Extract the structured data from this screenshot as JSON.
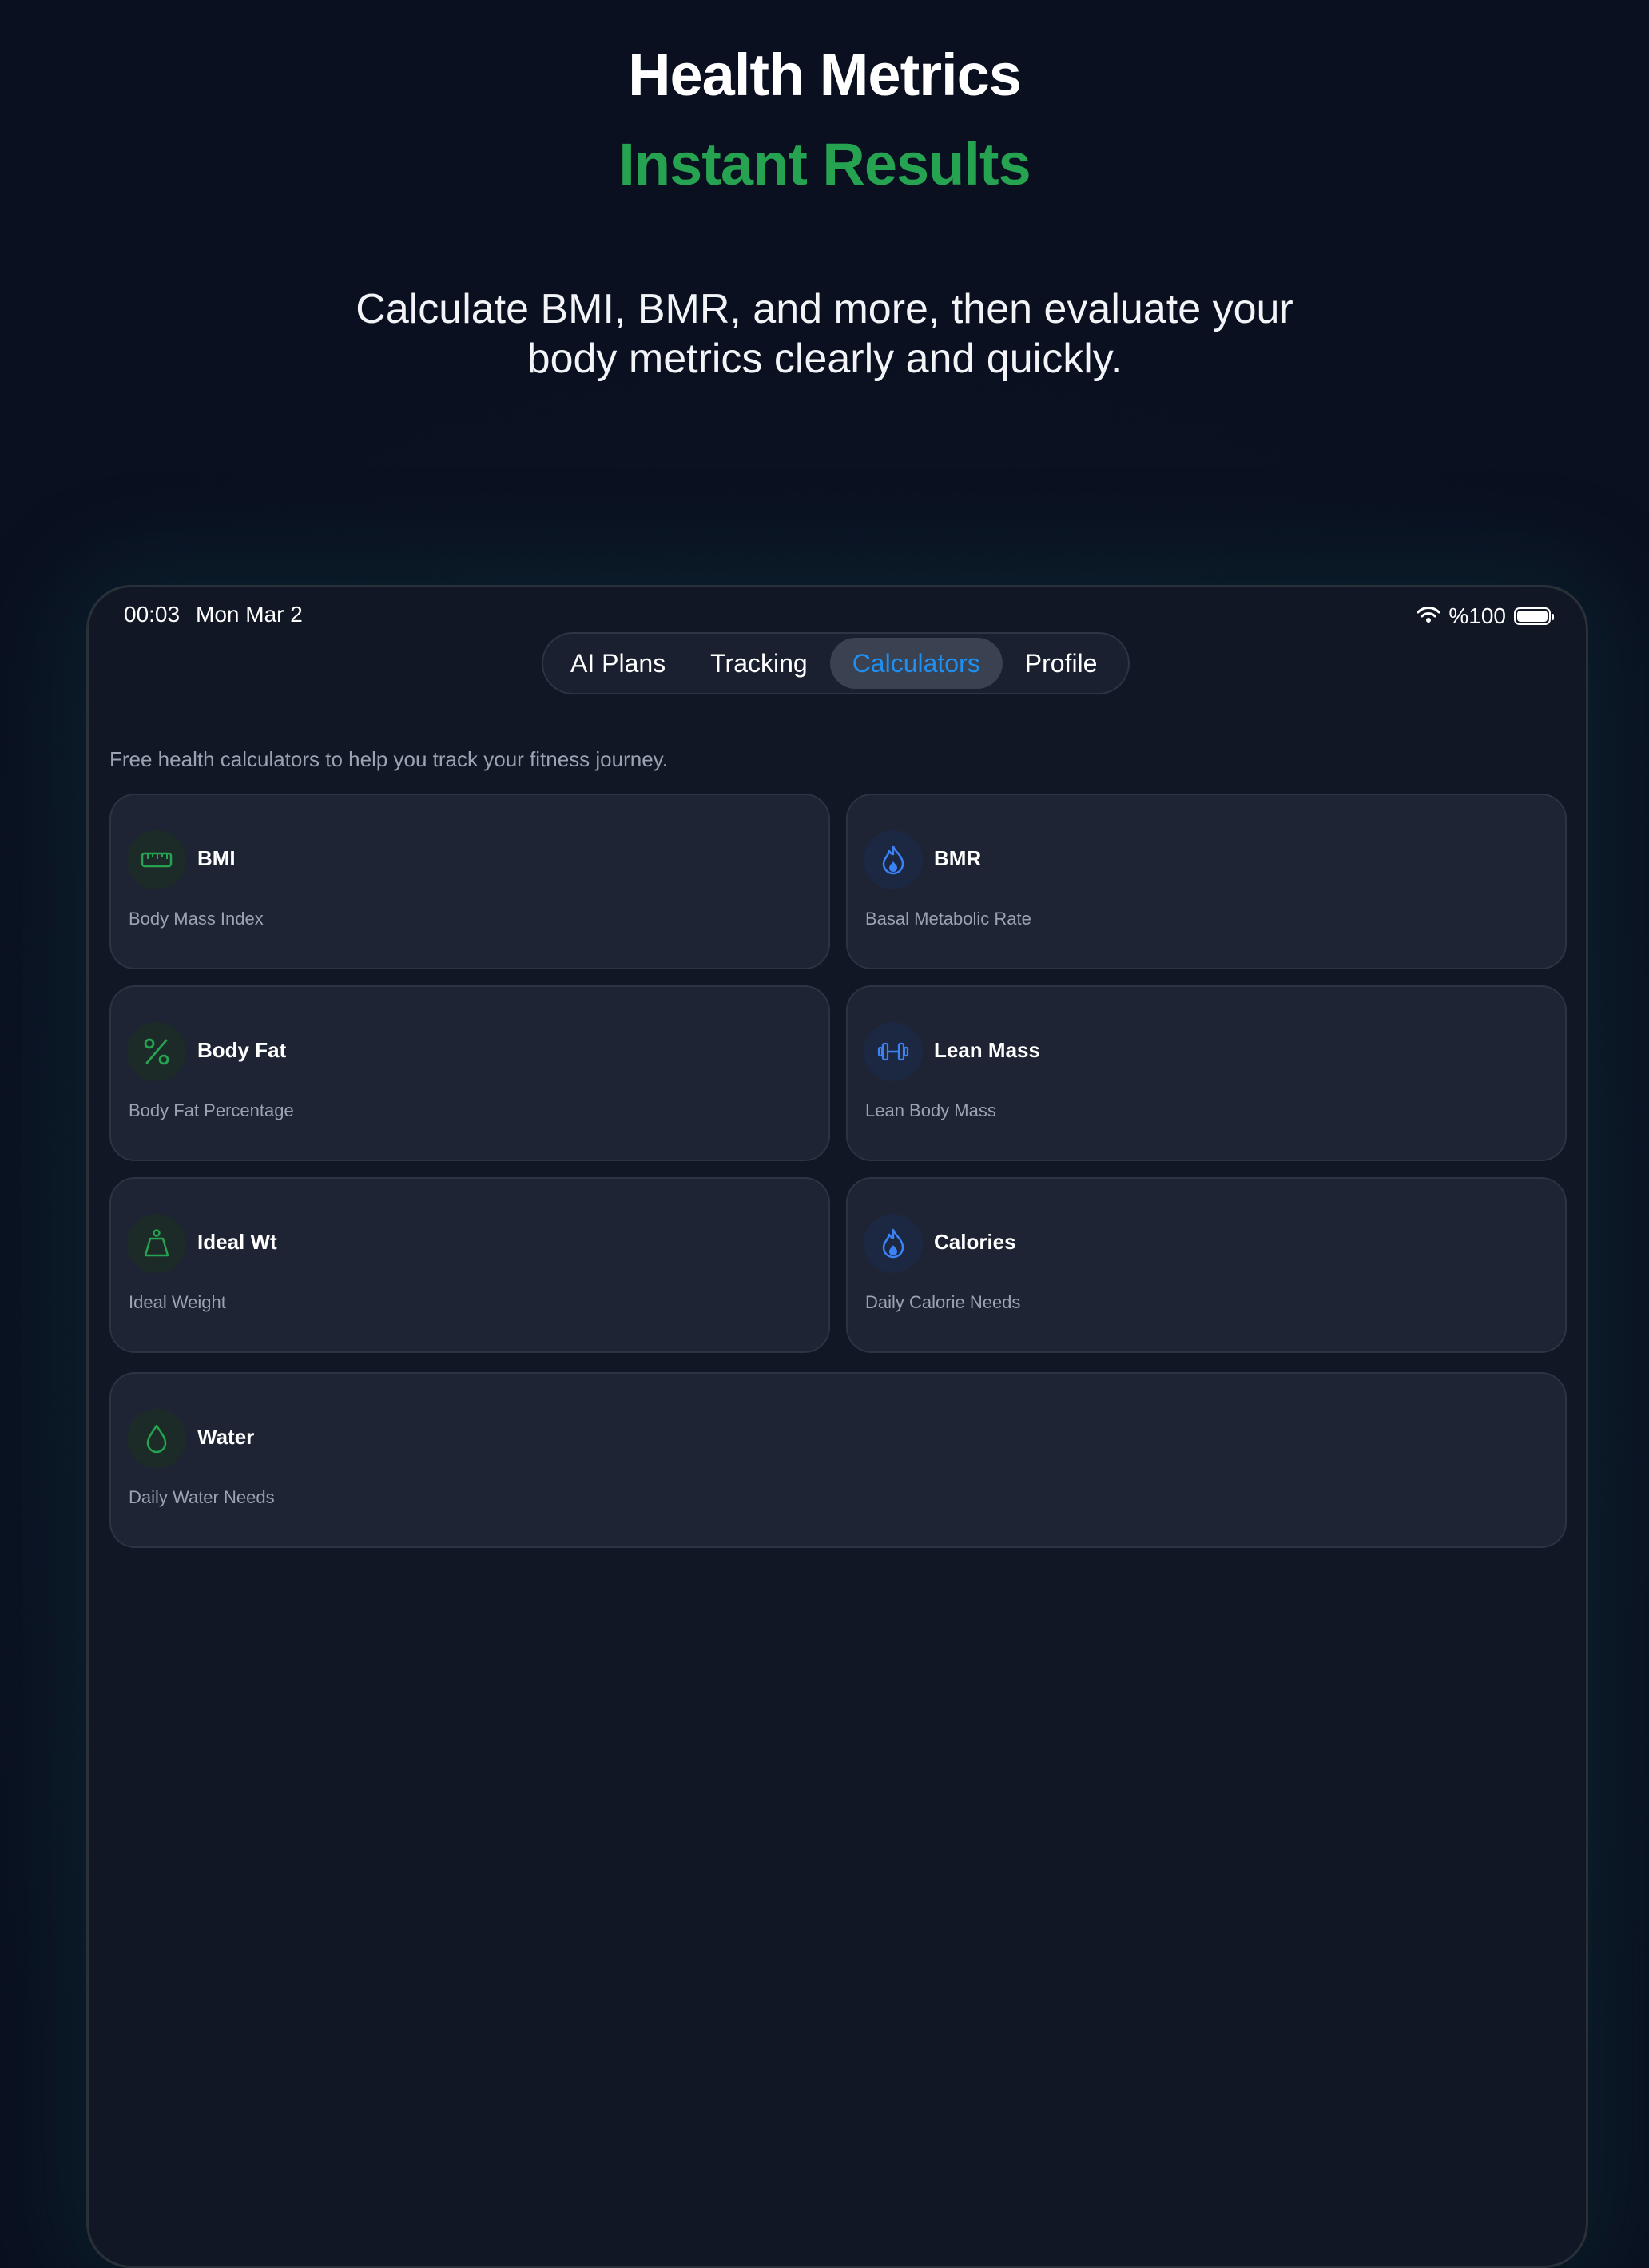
{
  "hero": {
    "title": "Health Metrics",
    "subtitle": "Instant Results",
    "description": "Calculate BMI, BMR, and more, then evaluate your body metrics clearly and quickly."
  },
  "status_bar": {
    "time": "00:03",
    "date": "Mon Mar 2",
    "battery": "%100"
  },
  "tabs": [
    {
      "label": "AI Plans",
      "active": false
    },
    {
      "label": "Tracking",
      "active": false
    },
    {
      "label": "Calculators",
      "active": true
    },
    {
      "label": "Profile",
      "active": false
    }
  ],
  "intro": "Free health calculators to help you track your fitness journey.",
  "calculators": [
    {
      "title": "BMI",
      "subtitle": "Body Mass Index",
      "icon": "ruler-icon",
      "accent": "#26a350"
    },
    {
      "title": "BMR",
      "subtitle": "Basal Metabolic Rate",
      "icon": "flame-icon",
      "accent": "#3b82f6"
    },
    {
      "title": "Body Fat",
      "subtitle": "Body Fat Percentage",
      "icon": "percent-icon",
      "accent": "#26a350"
    },
    {
      "title": "Lean Mass",
      "subtitle": "Lean Body Mass",
      "icon": "dumbbell-icon",
      "accent": "#3b82f6"
    },
    {
      "title": "Ideal Wt",
      "subtitle": "Ideal Weight",
      "icon": "weight-icon",
      "accent": "#26a350"
    },
    {
      "title": "Calories",
      "subtitle": "Daily Calorie Needs",
      "icon": "flame-icon",
      "accent": "#3b82f6"
    },
    {
      "title": "Water",
      "subtitle": "Daily Water Needs",
      "icon": "droplet-icon",
      "accent": "#26a350"
    }
  ],
  "colors": {
    "accent_green": "#26a350",
    "accent_blue": "#1f8ff0",
    "card_bg": "#1e2433",
    "device_bg": "#121725"
  }
}
